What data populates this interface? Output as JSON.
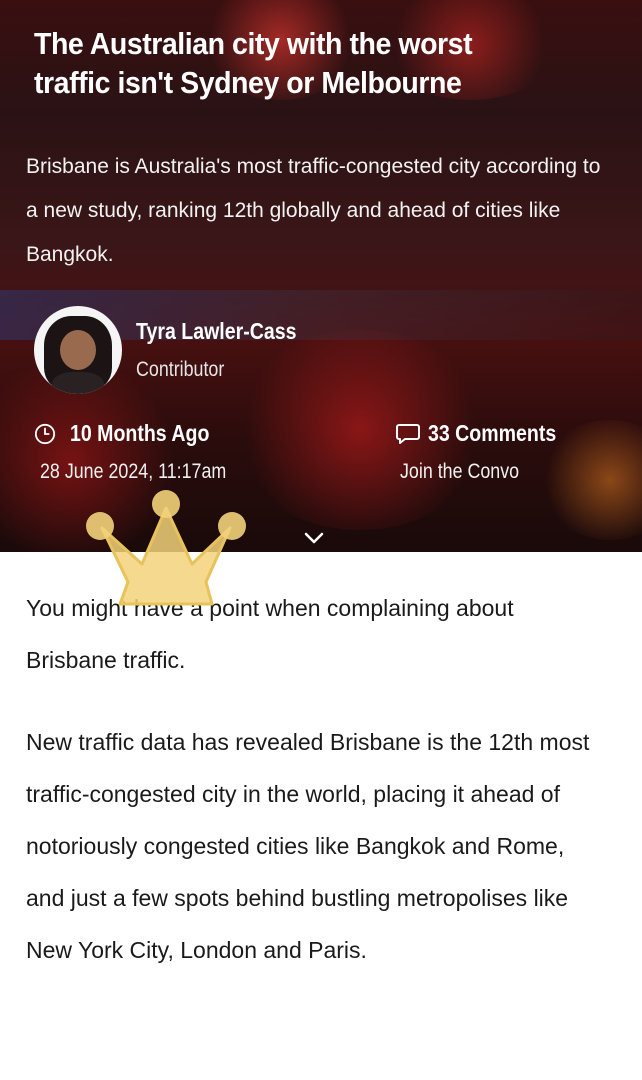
{
  "article": {
    "title": "The Australian city with the worst traffic isn't Sydney or Melbourne",
    "subtitle": "Brisbane is Australia's most traffic-congested city according to a new study, ranking 12th globally and ahead of cities like Bangkok.",
    "author": {
      "name": "Tyra Lawler-Cass",
      "role": "Contributor"
    },
    "time_ago": "10 Months Ago",
    "date": "28 June 2024, 11:17am",
    "comments": "33 Comments",
    "comments_cta": "Join the Convo",
    "paragraphs": [
      "You might have a point when complaining about Brisbane traffic.",
      "New traffic data has revealed Brisbane is the 12th most traffic-congested city in the world, placing it ahead of notoriously congested cities like Bangkok and Rome, and just a few spots behind bustling metropolises like New York City, London and Paris."
    ]
  },
  "icons": {
    "clock": "clock-icon",
    "comment": "comment-icon",
    "expand": "chevron-down-icon",
    "sticker": "crown-icon"
  },
  "colors": {
    "hero_overlay": "#2a1214",
    "sticker": "#f2d27a",
    "text": "#1a1a1a"
  }
}
